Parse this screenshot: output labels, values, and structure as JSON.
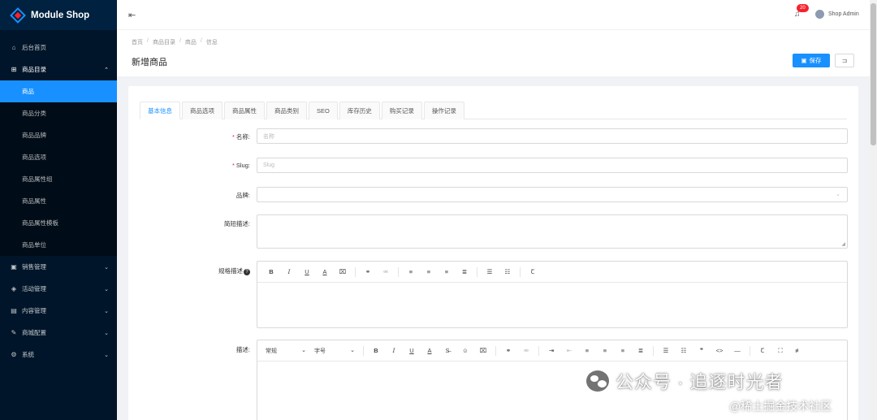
{
  "app": {
    "title": "Module Shop"
  },
  "sidebar": {
    "items": [
      {
        "label": "后台首页",
        "icon": "home-icon",
        "glyph": "⌂"
      },
      {
        "label": "商品目录",
        "icon": "cluster-icon",
        "glyph": "⊞",
        "open": true,
        "children": [
          {
            "label": "商品",
            "active": true
          },
          {
            "label": "商品分类"
          },
          {
            "label": "商品品牌"
          },
          {
            "label": "商品选项"
          },
          {
            "label": "商品属性组"
          },
          {
            "label": "商品属性"
          },
          {
            "label": "商品属性模板"
          },
          {
            "label": "商品单位"
          }
        ]
      },
      {
        "label": "销售管理",
        "icon": "bag-icon",
        "glyph": "▣"
      },
      {
        "label": "活动管理",
        "icon": "tag-icon",
        "glyph": "◈"
      },
      {
        "label": "内容管理",
        "icon": "file-icon",
        "glyph": "▤"
      },
      {
        "label": "商城配置",
        "icon": "wrench-icon",
        "glyph": "✎"
      },
      {
        "label": "系统",
        "icon": "system-icon",
        "glyph": "⚙"
      }
    ]
  },
  "header": {
    "notification_count": "20",
    "user_name": "Shop Admin"
  },
  "breadcrumb": [
    "首页",
    "商品目录",
    "商品",
    "信息"
  ],
  "page": {
    "title": "新增商品",
    "save_label": "保存",
    "back_label": "⊐"
  },
  "tabs": [
    "基本信息",
    "商品选项",
    "商品属性",
    "商品类别",
    "SEO",
    "库存历史",
    "购买记录",
    "操作记录"
  ],
  "form": {
    "name": {
      "label": "名称:",
      "placeholder": "名称"
    },
    "slug": {
      "label": "Slug:",
      "placeholder": "Slug"
    },
    "brand": {
      "label": "品牌:"
    },
    "short_desc": {
      "label": "简短描述:"
    },
    "spec_desc": {
      "label": "规格描述"
    },
    "desc": {
      "label": "描述:"
    }
  },
  "editor": {
    "font_style": "常规",
    "font_size": "字号"
  },
  "watermark": {
    "main": "公众号 · 追逐时光者",
    "sub": "@稀土掘金技术社区"
  },
  "colors": {
    "primary": "#1890ff",
    "sidebar_bg": "#001529",
    "badge": "#f5222d"
  }
}
